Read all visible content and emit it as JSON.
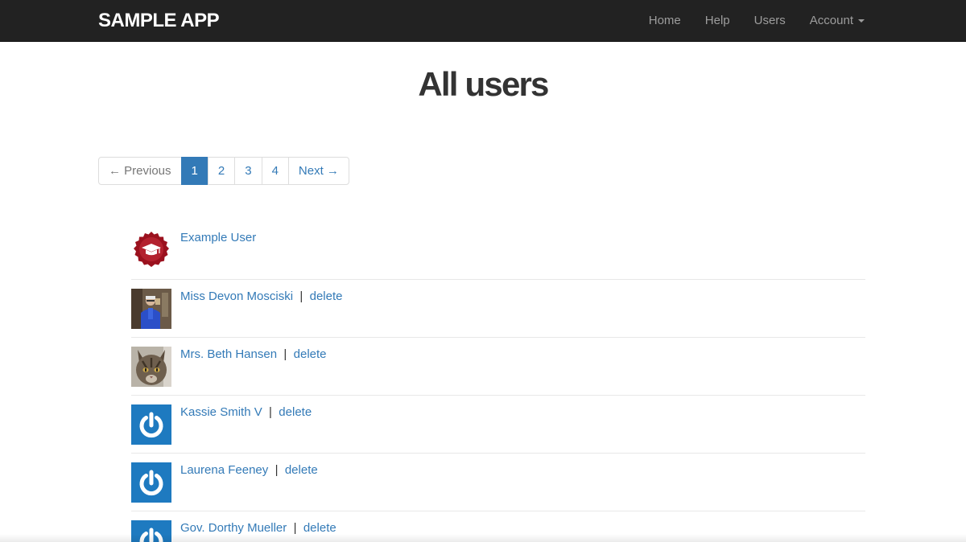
{
  "header": {
    "brand": "SAMPLE APP",
    "nav": [
      "Home",
      "Help",
      "Users",
      "Account"
    ]
  },
  "page": {
    "title": "All users"
  },
  "pagination": {
    "previous": "← Previous",
    "pages": [
      "1",
      "2",
      "3",
      "4"
    ],
    "current_page": "1",
    "next": "Next →"
  },
  "users": [
    {
      "name": "Example User",
      "avatar": "badge-icon"
    },
    {
      "name": "Miss Devon Mosciski",
      "avatar": "photo-person-icon",
      "separator": "|",
      "delete": "delete"
    },
    {
      "name": "Mrs. Beth Hansen",
      "avatar": "photo-cat-icon",
      "separator": "|",
      "delete": "delete"
    },
    {
      "name": "Kassie Smith V",
      "avatar": "power-icon",
      "separator": "|",
      "delete": "delete"
    },
    {
      "name": "Laurena Feeney",
      "avatar": "power-icon",
      "separator": "|",
      "delete": "delete"
    },
    {
      "name": "Gov. Dorthy Mueller",
      "avatar": "power-icon",
      "separator": "|",
      "delete": "delete"
    }
  ],
  "colors": {
    "navbar": "#222222",
    "link": "#337ab7",
    "badge": "#9b111e",
    "power_avatar": "#1e7ac0"
  }
}
